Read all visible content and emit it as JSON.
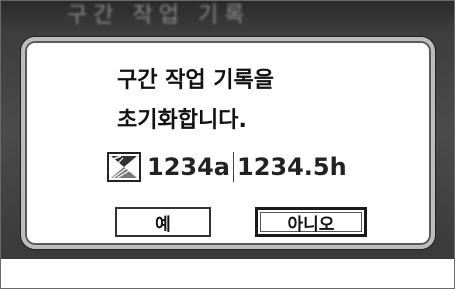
{
  "background": {
    "title": "구간 작업 기록"
  },
  "dialog": {
    "message_line1": "구간 작업 기록을",
    "message_line2": "초기화합니다.",
    "counter": {
      "icon": "hourglass-icon",
      "count_value": "1234a",
      "hours_value": "1234.5h"
    },
    "buttons": {
      "yes_label": "예",
      "no_label": "아니오"
    }
  }
}
